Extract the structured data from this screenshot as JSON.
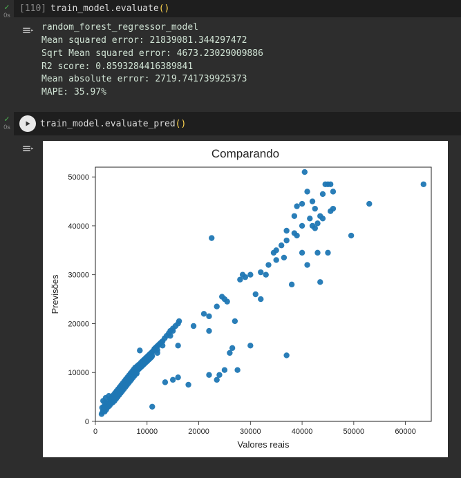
{
  "cell1": {
    "status_time": "0s",
    "exec_label": "[110]",
    "code_var": "train_model",
    "code_dot": ".",
    "code_method": "evaluate",
    "code_paren_open": "(",
    "code_paren_close": ")",
    "out_line1": "random_forest_regressor_model",
    "out_line2": "Mean squared error: 21839081.344297472",
    "out_line3": "Sqrt Mean squared error: 4673.23029009886",
    "out_line4": "R2 score: 0.8593284416389841",
    "out_line5": "Mean absolute error: 2719.741739925373",
    "out_line6": "MAPE: 35.97%"
  },
  "cell2": {
    "status_time": "0s",
    "code_var": "train_model",
    "code_dot": ".",
    "code_method": "evaluate_pred",
    "code_paren_open": "(",
    "code_paren_close": ")"
  },
  "chart_data": {
    "type": "scatter",
    "title": "Comparando",
    "xlabel": "Valores reais",
    "ylabel": "Previsões",
    "xlim": [
      0,
      65000
    ],
    "ylim": [
      0,
      52000
    ],
    "xticks": [
      0,
      10000,
      20000,
      30000,
      40000,
      50000,
      60000
    ],
    "yticks": [
      0,
      10000,
      20000,
      30000,
      40000,
      50000
    ],
    "points": [
      [
        1200,
        1500
      ],
      [
        1300,
        2800
      ],
      [
        1400,
        1900
      ],
      [
        1500,
        4200
      ],
      [
        1500,
        2200
      ],
      [
        1600,
        3000
      ],
      [
        1700,
        2500
      ],
      [
        1800,
        2000
      ],
      [
        1800,
        3800
      ],
      [
        1900,
        2700
      ],
      [
        2000,
        3200
      ],
      [
        2000,
        4800
      ],
      [
        2100,
        2400
      ],
      [
        2200,
        3600
      ],
      [
        2300,
        2900
      ],
      [
        2400,
        3500
      ],
      [
        2500,
        4000
      ],
      [
        2500,
        3000
      ],
      [
        2600,
        5200
      ],
      [
        2700,
        3800
      ],
      [
        2800,
        3300
      ],
      [
        2900,
        4600
      ],
      [
        3000,
        4100
      ],
      [
        3100,
        3700
      ],
      [
        3200,
        5000
      ],
      [
        3300,
        4400
      ],
      [
        3400,
        3900
      ],
      [
        3500,
        5400
      ],
      [
        3600,
        4700
      ],
      [
        3700,
        4200
      ],
      [
        3800,
        5800
      ],
      [
        3900,
        5100
      ],
      [
        4000,
        4600
      ],
      [
        4100,
        6200
      ],
      [
        4200,
        5500
      ],
      [
        4300,
        5000
      ],
      [
        4400,
        6600
      ],
      [
        4500,
        5900
      ],
      [
        4600,
        5400
      ],
      [
        4700,
        7000
      ],
      [
        4800,
        6300
      ],
      [
        4900,
        5800
      ],
      [
        5000,
        7400
      ],
      [
        5100,
        6700
      ],
      [
        5200,
        6200
      ],
      [
        5300,
        7800
      ],
      [
        5400,
        7100
      ],
      [
        5500,
        6600
      ],
      [
        5600,
        8200
      ],
      [
        5700,
        7500
      ],
      [
        5800,
        7000
      ],
      [
        5900,
        8600
      ],
      [
        6000,
        7900
      ],
      [
        6100,
        7400
      ],
      [
        6200,
        9000
      ],
      [
        6300,
        8300
      ],
      [
        6400,
        7800
      ],
      [
        6500,
        9400
      ],
      [
        6600,
        8700
      ],
      [
        6700,
        8200
      ],
      [
        6800,
        9800
      ],
      [
        6900,
        9100
      ],
      [
        7000,
        8600
      ],
      [
        7100,
        10200
      ],
      [
        7200,
        9500
      ],
      [
        7300,
        9000
      ],
      [
        7400,
        10600
      ],
      [
        7500,
        9900
      ],
      [
        7600,
        9400
      ],
      [
        7700,
        11000
      ],
      [
        7800,
        10300
      ],
      [
        7900,
        9800
      ],
      [
        8000,
        11200
      ],
      [
        8000,
        9800
      ],
      [
        8100,
        10400
      ],
      [
        8200,
        11400
      ],
      [
        8300,
        10600
      ],
      [
        8400,
        11600
      ],
      [
        8500,
        10800
      ],
      [
        8600,
        14500
      ],
      [
        8700,
        11000
      ],
      [
        8800,
        12000
      ],
      [
        8900,
        11200
      ],
      [
        9000,
        12200
      ],
      [
        9000,
        11500
      ],
      [
        9100,
        11400
      ],
      [
        9200,
        12400
      ],
      [
        9300,
        11600
      ],
      [
        9400,
        12600
      ],
      [
        9500,
        11800
      ],
      [
        9600,
        12800
      ],
      [
        9700,
        12000
      ],
      [
        9800,
        13000
      ],
      [
        9900,
        12200
      ],
      [
        10000,
        13200
      ],
      [
        10100,
        12400
      ],
      [
        10200,
        13400
      ],
      [
        10300,
        12600
      ],
      [
        10400,
        13600
      ],
      [
        10500,
        12800
      ],
      [
        10600,
        13800
      ],
      [
        10700,
        13000
      ],
      [
        10800,
        14000
      ],
      [
        10900,
        13200
      ],
      [
        11000,
        14200
      ],
      [
        11000,
        13400
      ],
      [
        11200,
        14400
      ],
      [
        11400,
        14800
      ],
      [
        11600,
        15000
      ],
      [
        11800,
        15200
      ],
      [
        12000,
        15400
      ],
      [
        12000,
        14600
      ],
      [
        12200,
        15600
      ],
      [
        12400,
        15800
      ],
      [
        12600,
        16000
      ],
      [
        12800,
        16200
      ],
      [
        13000,
        16400
      ],
      [
        13000,
        15500
      ],
      [
        13400,
        17000
      ],
      [
        13800,
        17500
      ],
      [
        14200,
        18000
      ],
      [
        14500,
        18500
      ],
      [
        14500,
        17500
      ],
      [
        15000,
        19000
      ],
      [
        15000,
        18500
      ],
      [
        15500,
        19500
      ],
      [
        16000,
        20000
      ],
      [
        16000,
        15500
      ],
      [
        16200,
        20500
      ],
      [
        11000,
        3000
      ],
      [
        12000,
        14000
      ],
      [
        13500,
        8000
      ],
      [
        15000,
        8500
      ],
      [
        16000,
        9000
      ],
      [
        18000,
        7500
      ],
      [
        19000,
        19500
      ],
      [
        21000,
        22000
      ],
      [
        22000,
        21500
      ],
      [
        22000,
        18500
      ],
      [
        22000,
        9500
      ],
      [
        22500,
        37500
      ],
      [
        23500,
        8500
      ],
      [
        23500,
        23500
      ],
      [
        24000,
        9500
      ],
      [
        24500,
        25500
      ],
      [
        25000,
        25000
      ],
      [
        25000,
        10500
      ],
      [
        25500,
        24500
      ],
      [
        26000,
        14000
      ],
      [
        26500,
        15000
      ],
      [
        27000,
        20500
      ],
      [
        27500,
        10500
      ],
      [
        28000,
        29000
      ],
      [
        28500,
        30000
      ],
      [
        29000,
        29500
      ],
      [
        30000,
        15500
      ],
      [
        30000,
        30000
      ],
      [
        31000,
        26000
      ],
      [
        32000,
        30500
      ],
      [
        32000,
        25000
      ],
      [
        33000,
        30000
      ],
      [
        33500,
        32000
      ],
      [
        34500,
        34500
      ],
      [
        35000,
        35000
      ],
      [
        35000,
        33000
      ],
      [
        36000,
        36000
      ],
      [
        36500,
        33500
      ],
      [
        37000,
        37000
      ],
      [
        37000,
        39000
      ],
      [
        37000,
        13500
      ],
      [
        38000,
        28000
      ],
      [
        38500,
        42000
      ],
      [
        38500,
        38500
      ],
      [
        39000,
        44000
      ],
      [
        39000,
        38000
      ],
      [
        40000,
        34500
      ],
      [
        40000,
        40000
      ],
      [
        40000,
        44500
      ],
      [
        40500,
        51000
      ],
      [
        41000,
        32000
      ],
      [
        41000,
        47000
      ],
      [
        41500,
        41500
      ],
      [
        42000,
        45000
      ],
      [
        42000,
        40000
      ],
      [
        42500,
        39500
      ],
      [
        42500,
        43500
      ],
      [
        43000,
        40500
      ],
      [
        43000,
        34500
      ],
      [
        43500,
        42000
      ],
      [
        43500,
        28500
      ],
      [
        44000,
        46500
      ],
      [
        44000,
        41500
      ],
      [
        44500,
        48500
      ],
      [
        45000,
        34500
      ],
      [
        45000,
        48500
      ],
      [
        45500,
        48500
      ],
      [
        45500,
        43000
      ],
      [
        46000,
        43500
      ],
      [
        46000,
        47000
      ],
      [
        49500,
        38000
      ],
      [
        53000,
        44500
      ],
      [
        63500,
        48500
      ]
    ]
  }
}
